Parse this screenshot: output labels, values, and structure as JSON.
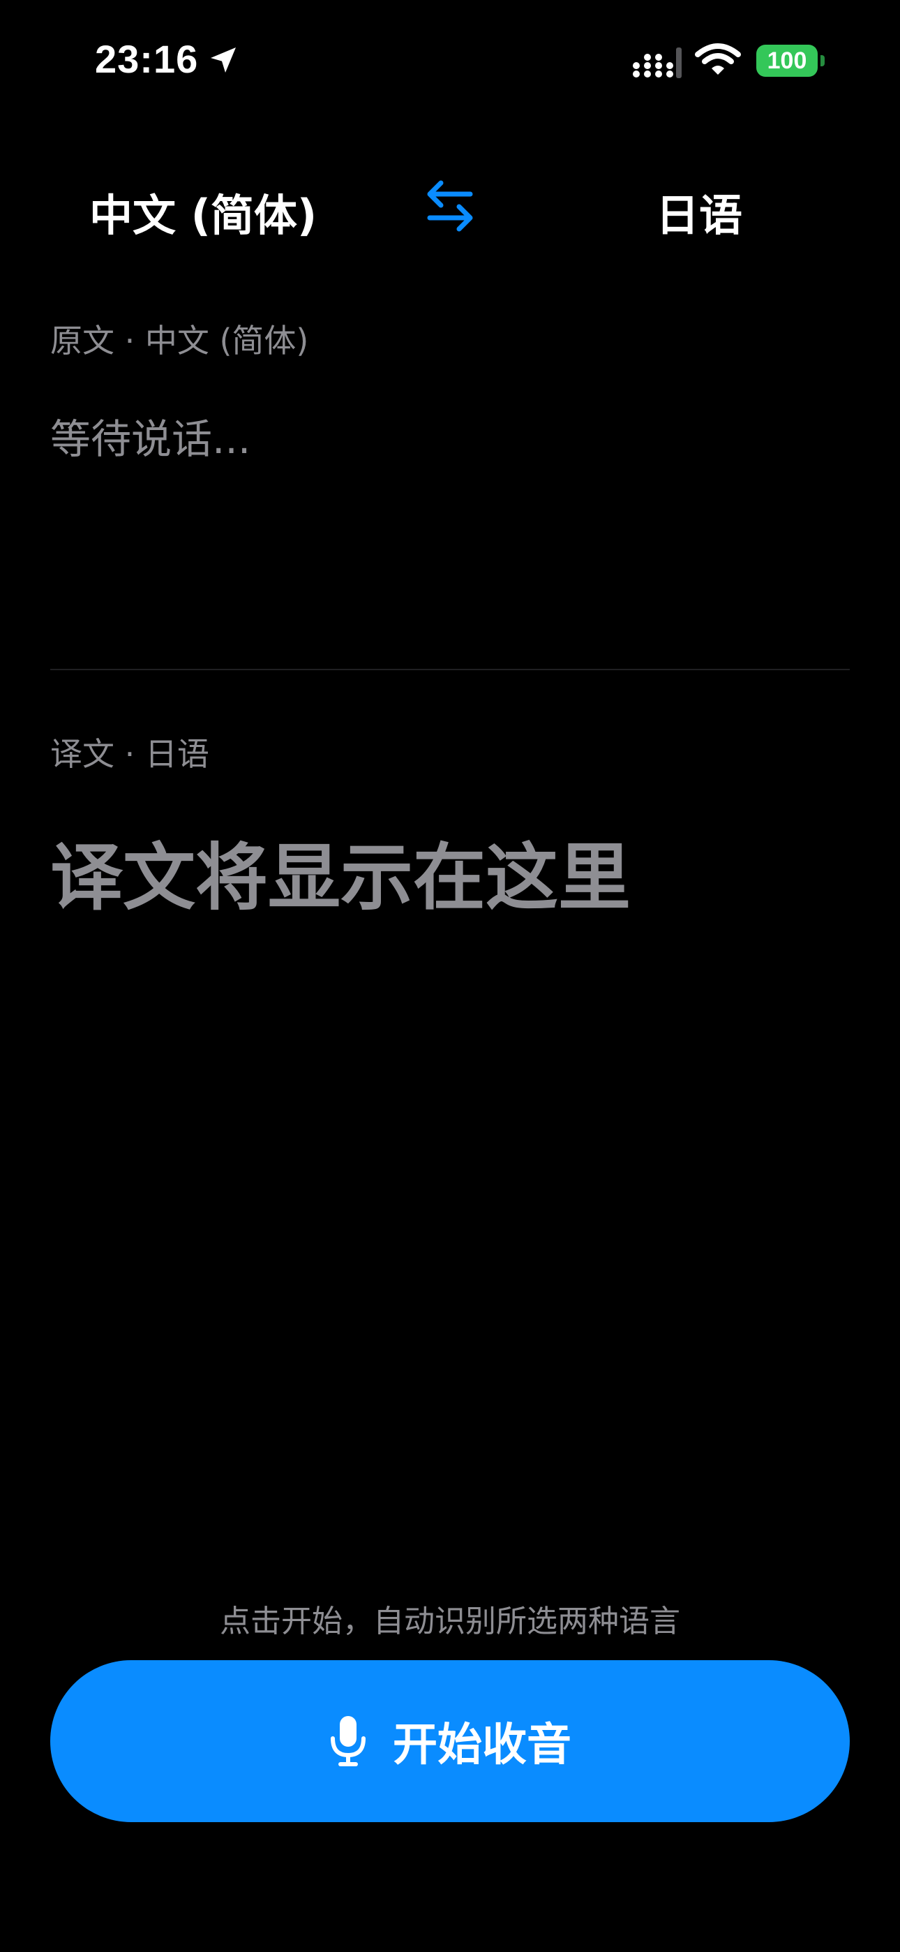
{
  "status_bar": {
    "time": "23:16",
    "battery": "100",
    "icons": [
      "location-arrow-icon",
      "cellular-signal-icon",
      "wifi-icon",
      "battery-icon"
    ]
  },
  "language_bar": {
    "source_language": "中文 (简体)",
    "target_language": "日语",
    "swap_icon": "swap-arrows-icon"
  },
  "source": {
    "label": "原文 · 中文 (简体)",
    "placeholder": "等待说话..."
  },
  "translation": {
    "label": "译文 · 日语",
    "placeholder": "译文将显示在这里"
  },
  "footer": {
    "hint": "点击开始，自动识别所选两种语言",
    "record_button_label": "开始收音",
    "record_icon": "microphone-icon"
  },
  "colors": {
    "background": "#000000",
    "accent": "#0a8cff",
    "secondary_text": "#8e8e93",
    "battery_green": "#34c759"
  }
}
